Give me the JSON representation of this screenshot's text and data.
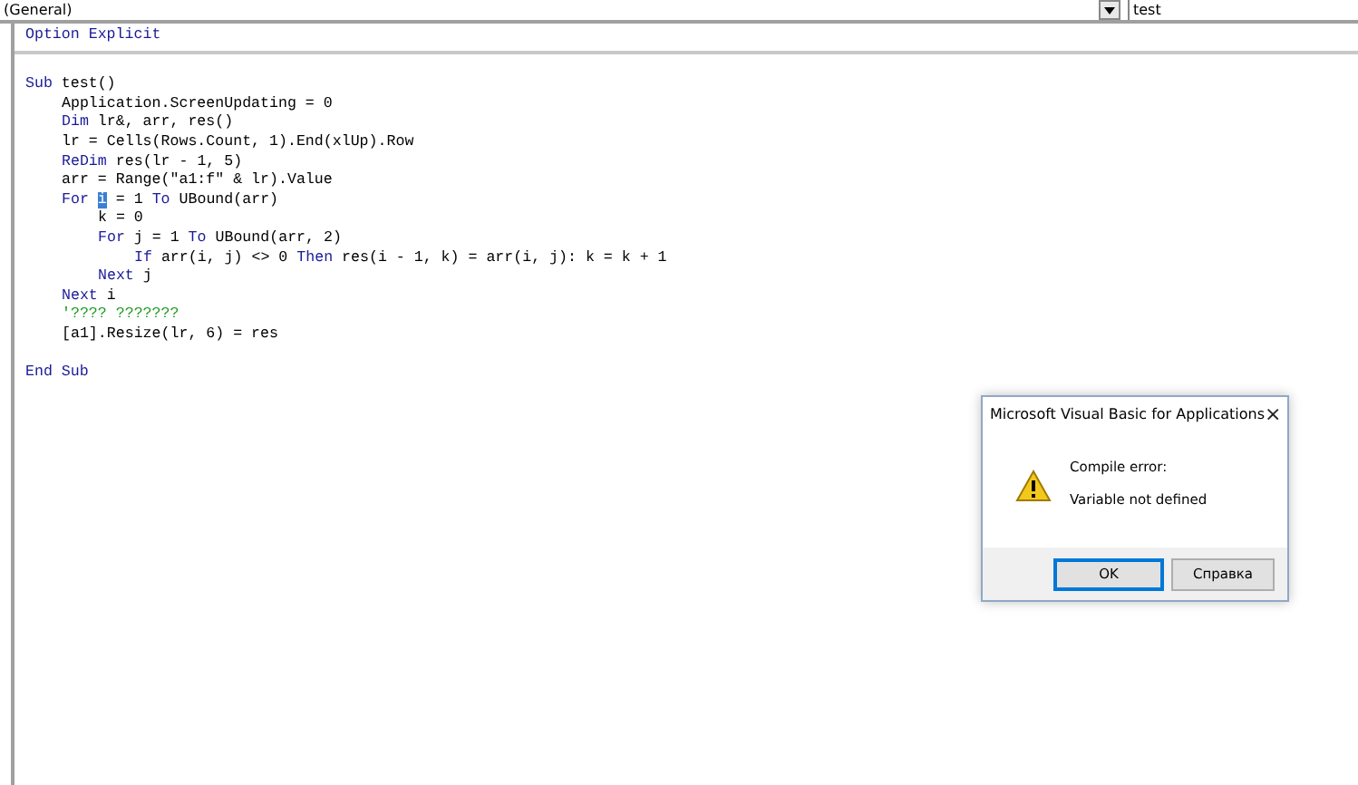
{
  "header": {
    "object_combo": "(General)",
    "procedure_combo": "test"
  },
  "declarations": [
    {
      "kind": "code",
      "tokens": [
        {
          "kind": "keyword",
          "text": "Option Explicit"
        }
      ]
    }
  ],
  "code_lines": [
    {
      "kind": "blank"
    },
    {
      "kind": "code",
      "tokens": [
        {
          "kind": "keyword",
          "text": "Sub"
        },
        {
          "kind": "plain",
          "text": " test()"
        }
      ],
      "children": [
        {
          "kind": "code",
          "tokens": [
            {
              "kind": "plain",
              "text": "Application.ScreenUpdating = 0"
            }
          ]
        },
        {
          "kind": "code",
          "tokens": [
            {
              "kind": "keyword",
              "text": "Dim"
            },
            {
              "kind": "plain",
              "text": " lr&, arr, res()"
            }
          ]
        },
        {
          "kind": "code",
          "tokens": [
            {
              "kind": "plain",
              "text": "lr = Cells(Rows.Count, 1).End(xlUp).Row"
            }
          ]
        },
        {
          "kind": "code",
          "tokens": [
            {
              "kind": "keyword",
              "text": "ReDim"
            },
            {
              "kind": "plain",
              "text": " res(lr - 1, 5)"
            }
          ]
        },
        {
          "kind": "code",
          "tokens": [
            {
              "kind": "plain",
              "text": "arr = Range(\"a1:f\" & lr).Value"
            }
          ]
        },
        {
          "kind": "code",
          "tokens": [
            {
              "kind": "keyword",
              "text": "For "
            },
            {
              "kind": "selection",
              "text": "i"
            },
            {
              "kind": "plain",
              "text": " = 1 "
            },
            {
              "kind": "keyword",
              "text": "To"
            },
            {
              "kind": "plain",
              "text": " UBound(arr)"
            }
          ],
          "children": [
            {
              "kind": "code",
              "tokens": [
                {
                  "kind": "plain",
                  "text": "k = 0"
                }
              ]
            },
            {
              "kind": "code",
              "tokens": [
                {
                  "kind": "keyword",
                  "text": "For"
                },
                {
                  "kind": "plain",
                  "text": " j = 1 "
                },
                {
                  "kind": "keyword",
                  "text": "To"
                },
                {
                  "kind": "plain",
                  "text": " UBound(arr, 2)"
                }
              ],
              "children": [
                {
                  "kind": "code",
                  "tokens": [
                    {
                      "kind": "keyword",
                      "text": "If"
                    },
                    {
                      "kind": "plain",
                      "text": " arr(i, j) <> 0 "
                    },
                    {
                      "kind": "keyword",
                      "text": "Then"
                    },
                    {
                      "kind": "plain",
                      "text": " res(i - 1, k) = arr(i, j): k = k + 1"
                    }
                  ]
                }
              ]
            },
            {
              "kind": "code",
              "tokens": [
                {
                  "kind": "keyword",
                  "text": "Next"
                },
                {
                  "kind": "plain",
                  "text": " j"
                }
              ]
            }
          ]
        },
        {
          "kind": "code",
          "tokens": [
            {
              "kind": "keyword",
              "text": "Next"
            },
            {
              "kind": "plain",
              "text": " i"
            }
          ]
        },
        {
          "kind": "code",
          "tokens": [
            {
              "kind": "comment",
              "text": "'???? ???????"
            }
          ]
        },
        {
          "kind": "code",
          "tokens": [
            {
              "kind": "plain",
              "text": "[a1].Resize(lr, 6) = res"
            }
          ]
        }
      ]
    },
    {
      "kind": "blank"
    },
    {
      "kind": "code",
      "tokens": [
        {
          "kind": "keyword",
          "text": "End Sub"
        }
      ]
    }
  ],
  "dialog": {
    "title": "Microsoft Visual Basic for Applications",
    "close": "×",
    "heading": "Compile error:",
    "message": "Variable not defined",
    "buttons": [
      {
        "label": "OK",
        "selected": true
      },
      {
        "label": "Справка",
        "selected": false
      }
    ]
  }
}
